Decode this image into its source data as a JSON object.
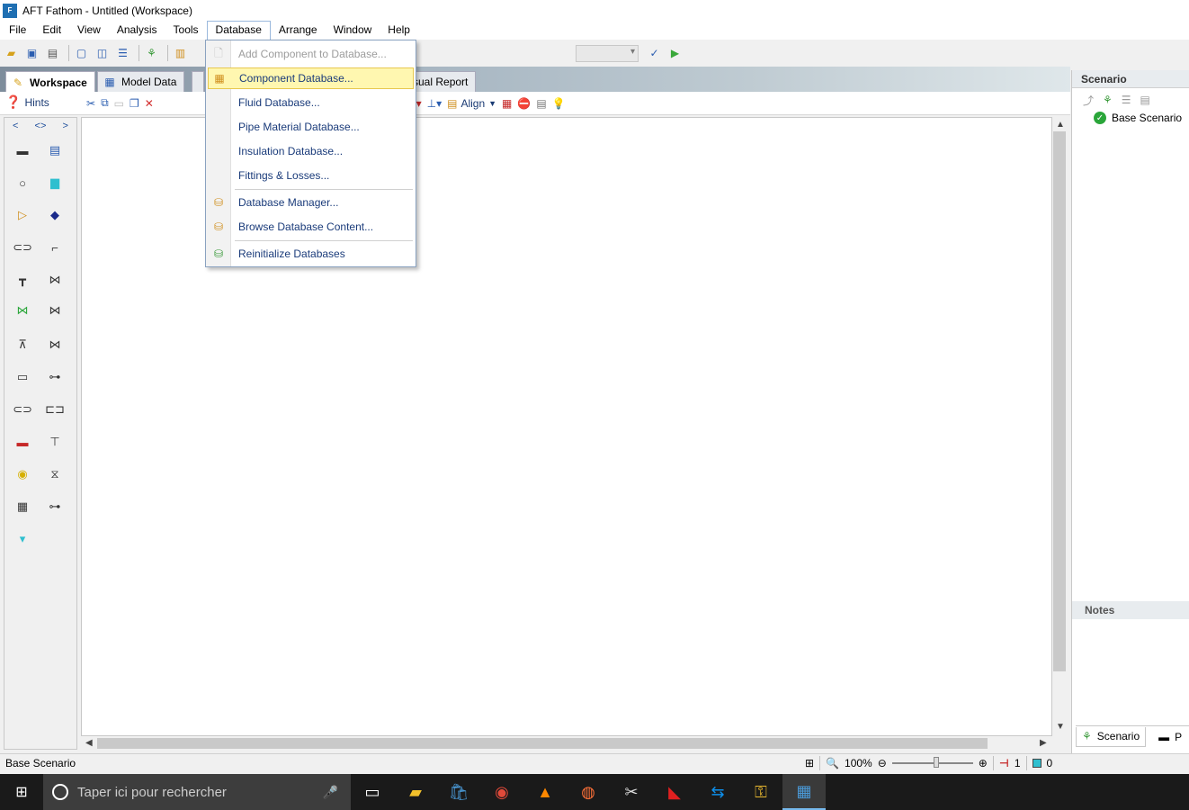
{
  "window": {
    "title": "AFT Fathom - Untitled (Workspace)",
    "app_icon_text": "F"
  },
  "menubar": {
    "items": [
      "File",
      "Edit",
      "View",
      "Analysis",
      "Tools",
      "Database",
      "Arrange",
      "Window",
      "Help"
    ]
  },
  "tabs": {
    "workspace": "Workspace",
    "model_data": "Model Data",
    "visual_report": "sual Report"
  },
  "toolbar2": {
    "hints": "Hints",
    "align": "Align"
  },
  "palette": {
    "prev": "<",
    "both": "<>",
    "next": ">"
  },
  "database_menu": {
    "items": [
      {
        "label": "Add Component to Database...",
        "enabled": false
      },
      {
        "label": "Component Database...",
        "enabled": true,
        "highlighted": true
      },
      {
        "label": "Fluid Database...",
        "enabled": true
      },
      {
        "label": "Pipe Material Database...",
        "enabled": true
      },
      {
        "label": "Insulation Database...",
        "enabled": true
      },
      {
        "label": "Fittings & Losses...",
        "enabled": true
      },
      {
        "label": "Database Manager...",
        "enabled": true
      },
      {
        "label": "Browse Database Content...",
        "enabled": true
      },
      {
        "label": "Reinitialize Databases",
        "enabled": true
      }
    ]
  },
  "scenario_panel": {
    "header": "Scenario",
    "tree_item": "Base Scenario",
    "notes_header": "Notes",
    "tab_scenario": "Scenario",
    "tab_other": "P"
  },
  "statusbar": {
    "scenario": "Base Scenario",
    "zoom": "100%",
    "pipe_count": "1",
    "junction_count": "0"
  },
  "taskbar": {
    "search_placeholder": "Taper ici pour rechercher",
    "apps": [
      "task-view",
      "file-explorer",
      "store",
      "chrome",
      "vlc",
      "firefox",
      "snipping",
      "avira",
      "teamviewer",
      "keys",
      "aft-fathom"
    ]
  }
}
